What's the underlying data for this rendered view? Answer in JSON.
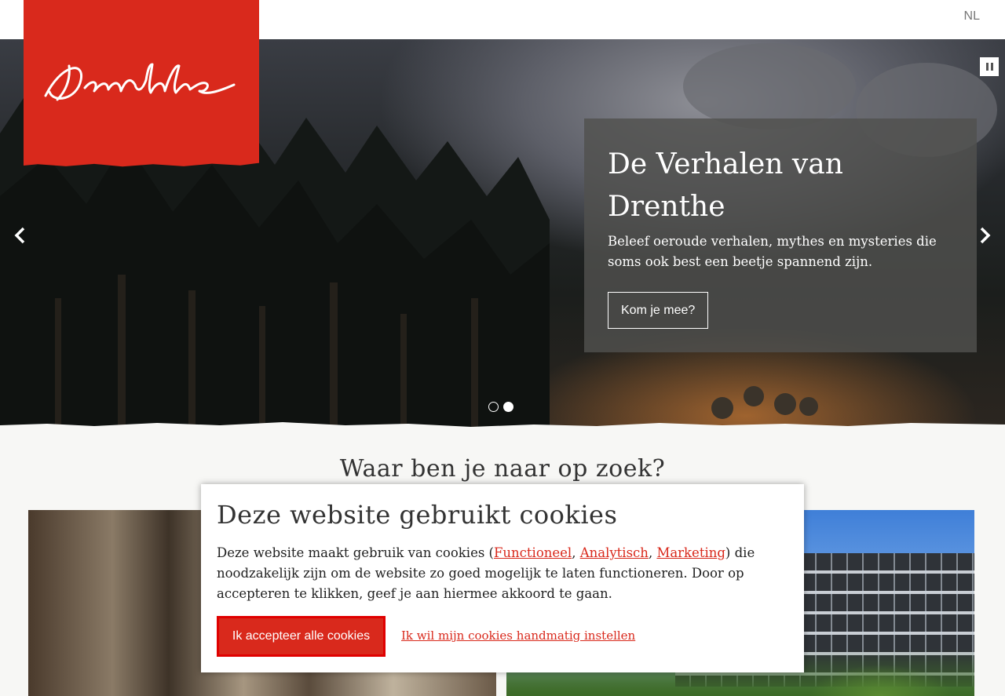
{
  "header": {
    "language": "NL",
    "logo_text": "Drenthe"
  },
  "hero": {
    "title": "De Verhalen van Drenthe",
    "text": "Beleef oeroude verhalen, mythes en mysteries die soms ook best een beetje spannend zijn.",
    "button_label": "Kom je mee?",
    "slides": [
      "slide-1",
      "slide-2"
    ],
    "active_slide": 2
  },
  "section": {
    "title": "Waar ben je naar op zoek?"
  },
  "cookies": {
    "title": "Deze website gebruikt cookies",
    "text_before": "Deze website maakt gebruik van cookies (",
    "link_functional": "Functioneel",
    "sep1": ", ",
    "link_analytic": "Analytisch",
    "sep2": ", ",
    "link_marketing": "Marketing",
    "text_after": ") die noodzakelijk zijn om de website zo goed mogelijk te laten functioneren. Door op accepteren te klikken, geef je aan hiermee akkoord te gaan.",
    "accept_label": "Ik accepteer alle cookies",
    "manual_label": "Ik wil mijn cookies handmatig instellen"
  },
  "colors": {
    "brand_red": "#d9291c",
    "panel": "#50504e",
    "page_bg": "#f7f7f5"
  }
}
